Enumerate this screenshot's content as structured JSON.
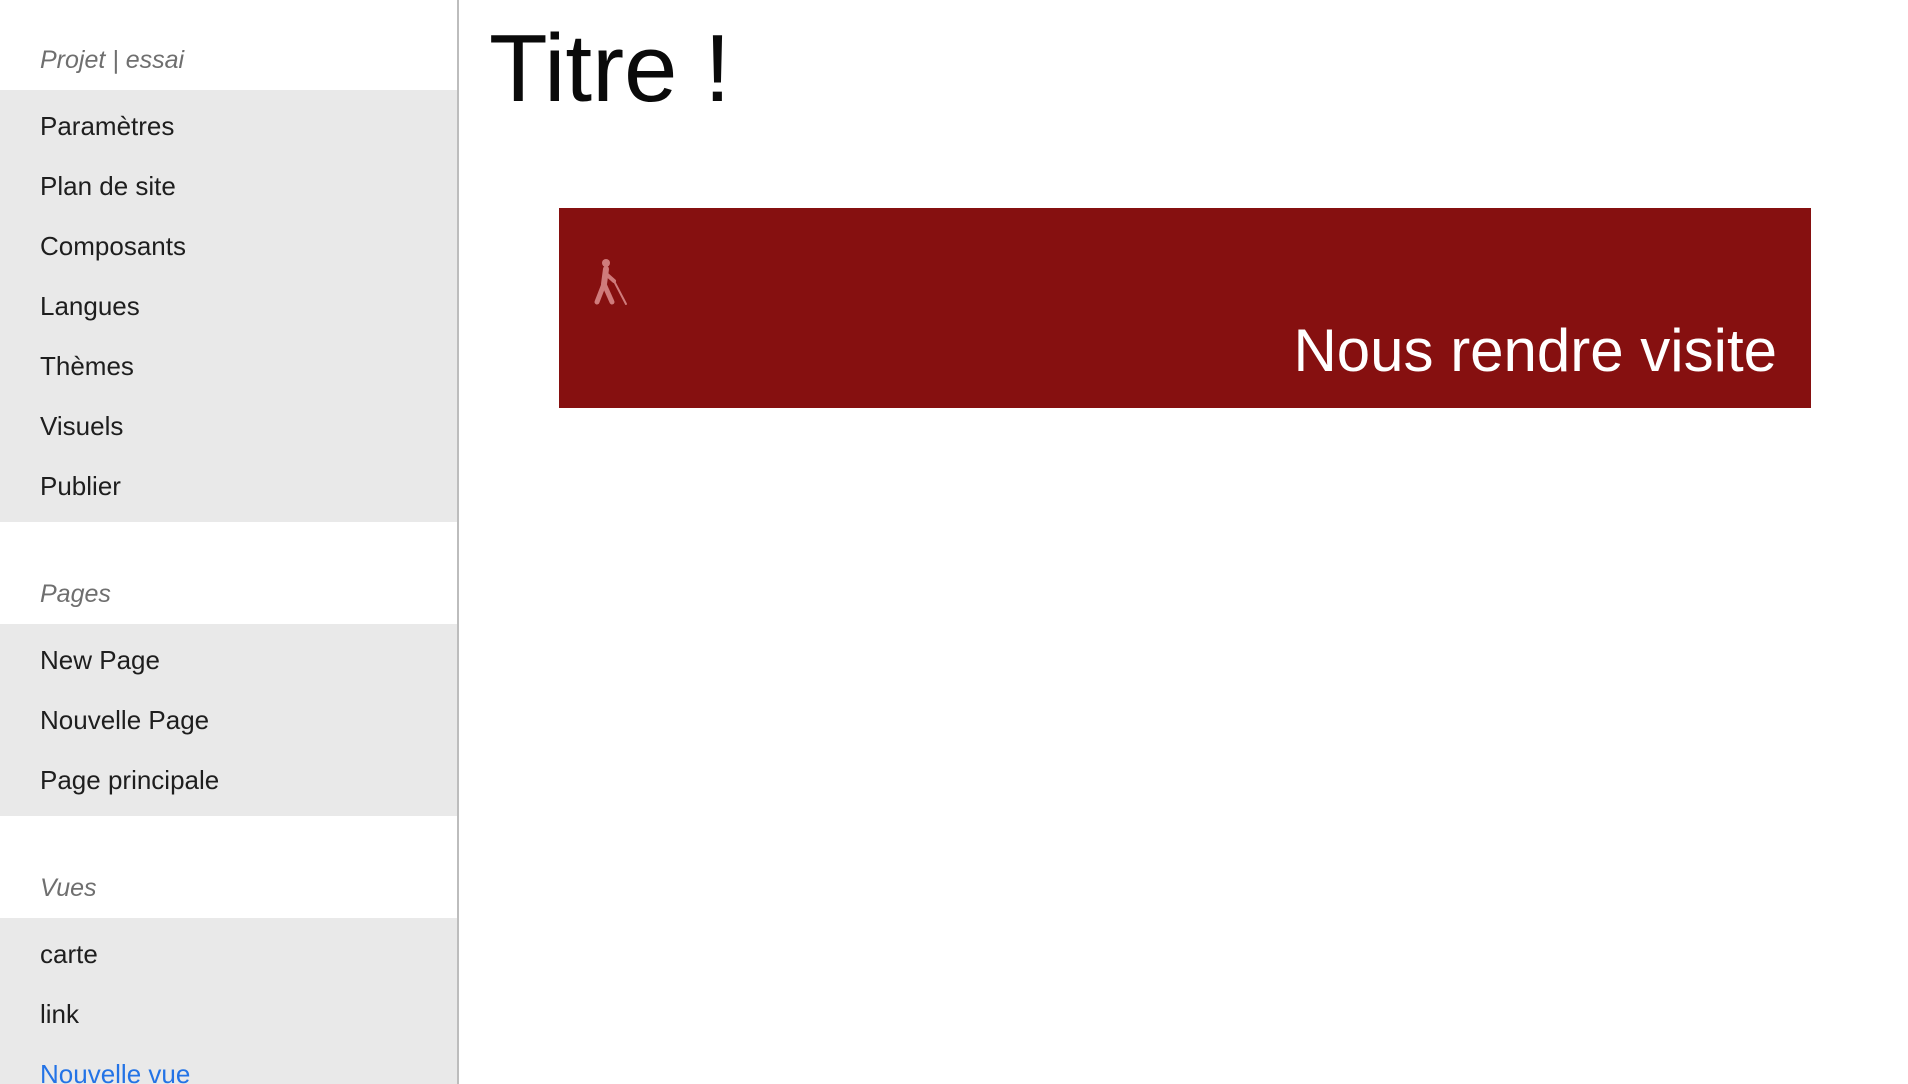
{
  "sidebar": {
    "project_heading": "Projet | essai",
    "project_items": [
      {
        "label": "Paramètres"
      },
      {
        "label": "Plan de site"
      },
      {
        "label": "Composants"
      },
      {
        "label": "Langues"
      },
      {
        "label": "Thèmes"
      },
      {
        "label": "Visuels"
      },
      {
        "label": "Publier"
      }
    ],
    "pages_heading": "Pages",
    "page_items": [
      {
        "label": "New Page"
      },
      {
        "label": "Nouvelle Page"
      },
      {
        "label": "Page principale"
      }
    ],
    "views_heading": "Vues",
    "view_items": [
      {
        "label": "carte"
      },
      {
        "label": "link"
      },
      {
        "label": "Nouvelle vue",
        "active": true
      }
    ]
  },
  "main": {
    "title": "Titre !",
    "banner": {
      "icon": "blind-person-walking-icon",
      "text": "Nous rendre visite",
      "background": "#861010"
    }
  },
  "colors": {
    "active_link": "#2373e6",
    "sidebar_list_bg": "#e9e9e9",
    "heading_gray": "#6f6f6f"
  }
}
